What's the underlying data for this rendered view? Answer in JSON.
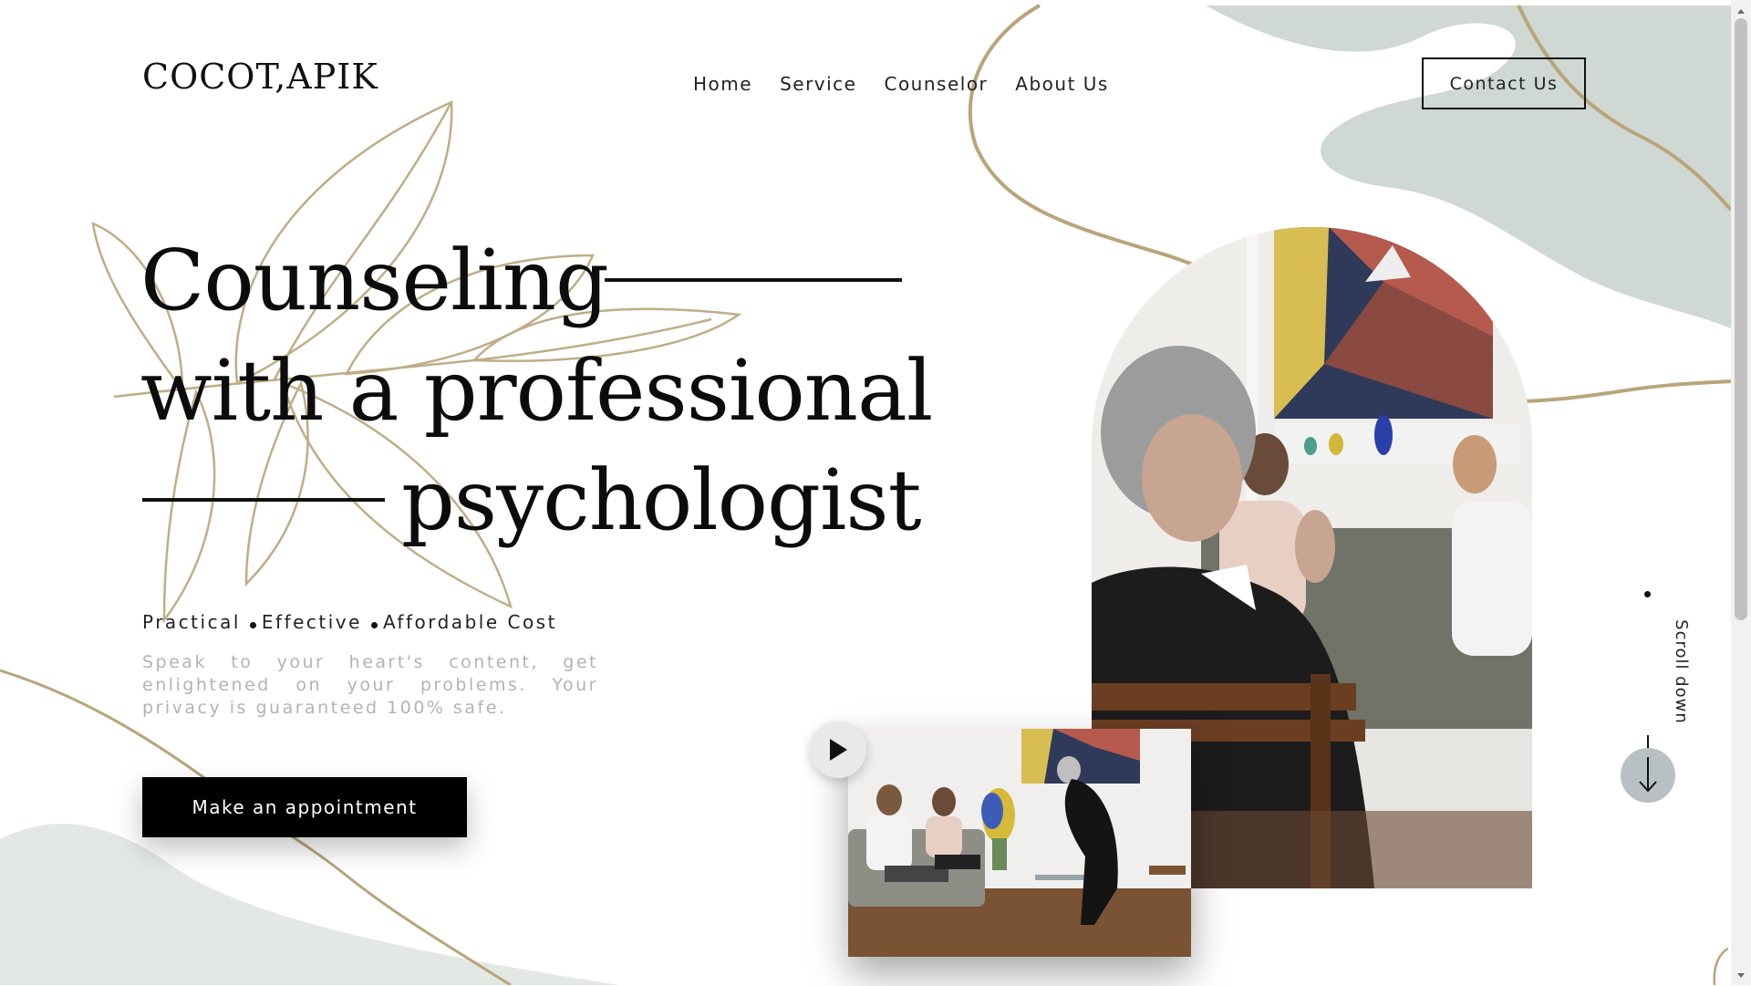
{
  "brand": {
    "logo": "COCOT,APIK"
  },
  "nav": {
    "items": [
      {
        "label": "Home"
      },
      {
        "label": "Service"
      },
      {
        "label": "Counselor"
      },
      {
        "label": "About Us"
      }
    ],
    "contact_label": "Contact Us"
  },
  "hero": {
    "line1": "Counseling",
    "line2": "with a professional",
    "line3": "psychologist",
    "tagline": {
      "item1": "Practical",
      "item2": "Effective",
      "item3": "Affordable Cost"
    },
    "description": "Speak to your heart's content, get enlightened on your problems. Your privacy is guaranteed 100% safe.",
    "cta_label": "Make an appointment"
  },
  "scroll": {
    "label": "Scroll down"
  },
  "colors": {
    "accent_gold": "#b9a57a",
    "sage": "#cfd8d2",
    "sage_light": "#e3e8e5",
    "black": "#000000",
    "scroll_circle": "#b8c0c3"
  },
  "icons": {
    "play": "play-icon",
    "arrow_down": "arrow-down-icon"
  }
}
